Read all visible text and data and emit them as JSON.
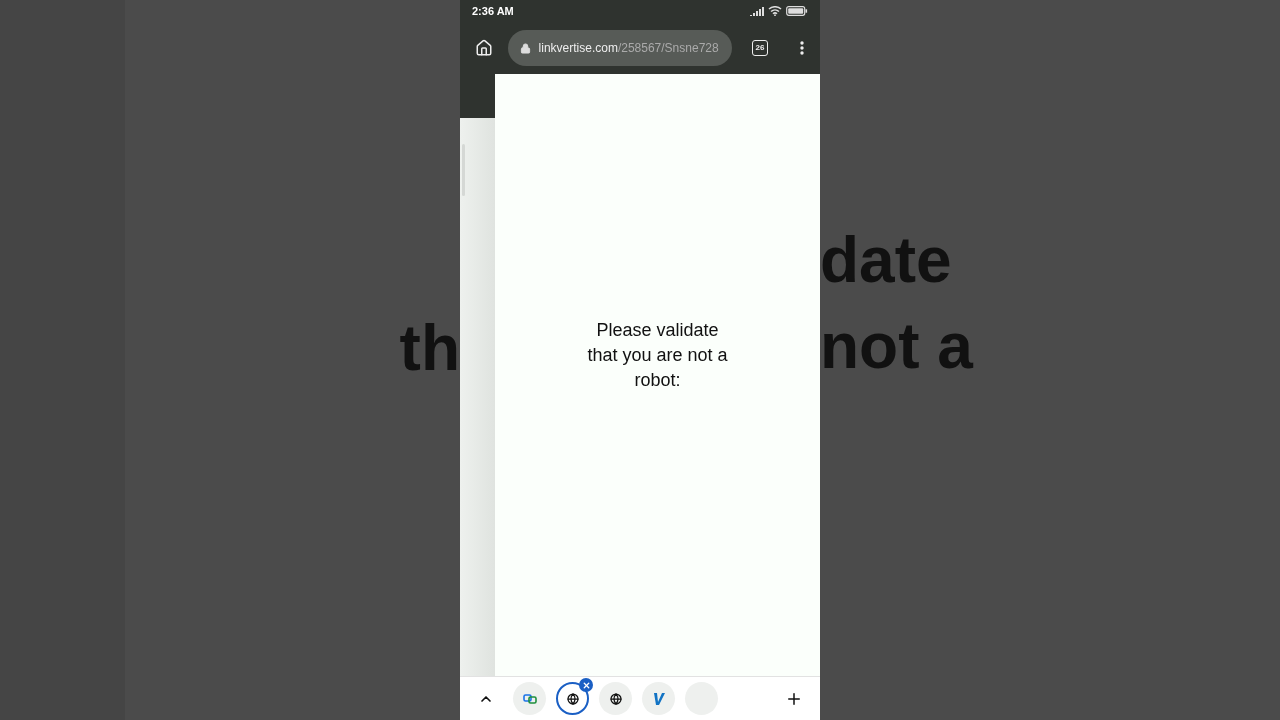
{
  "background_echo": {
    "left": [
      "th"
    ],
    "right": [
      "date",
      "not a"
    ]
  },
  "status_bar": {
    "time": "2:36 AM"
  },
  "toolbar": {
    "url_domain": "linkvertise.com",
    "url_path": "/258567/Snsne728",
    "tab_count": "26"
  },
  "page": {
    "message": "Please validate that you are not a robot:"
  },
  "tab_strip": {
    "tabs": [
      {
        "kind": "group",
        "selected": false
      },
      {
        "kind": "globe",
        "selected": true
      },
      {
        "kind": "globe",
        "selected": false
      },
      {
        "kind": "letter",
        "selected": false
      },
      {
        "kind": "blank",
        "selected": false
      }
    ]
  }
}
